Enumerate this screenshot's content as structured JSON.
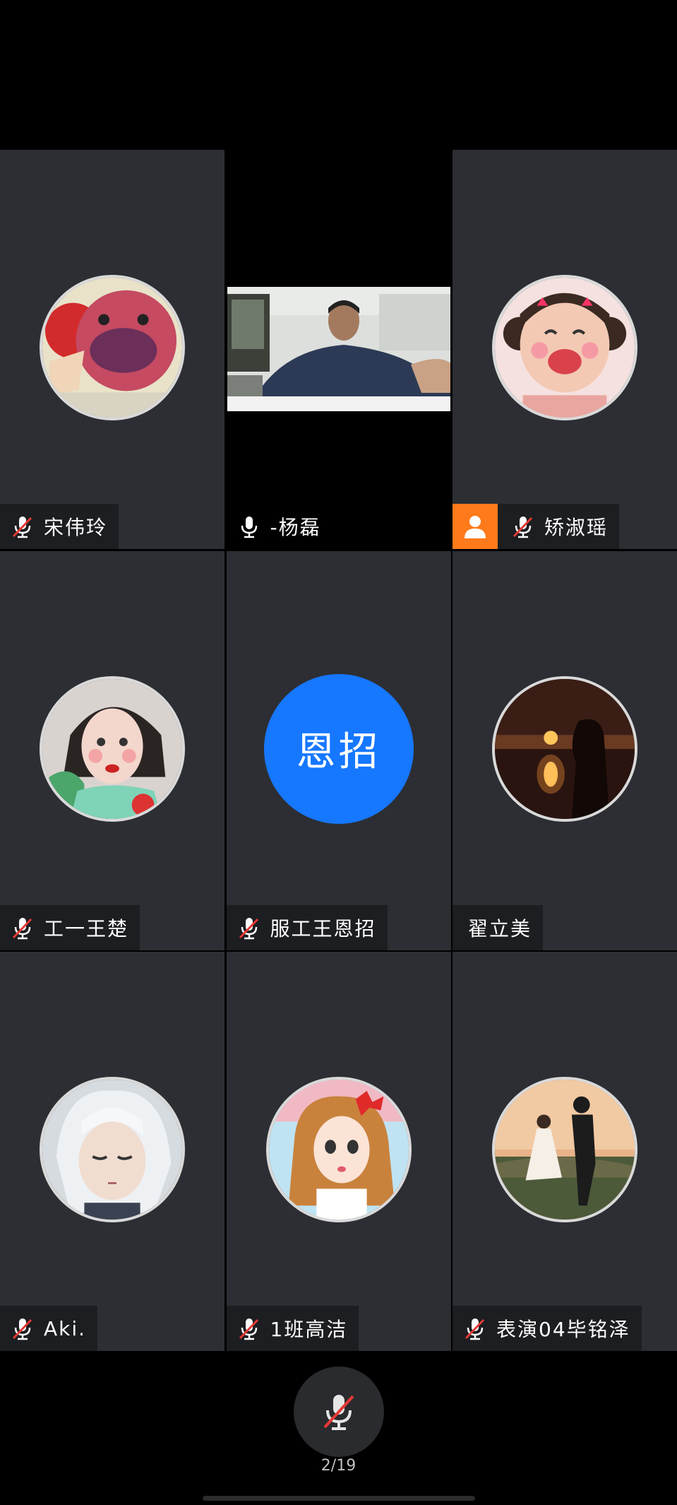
{
  "participants": [
    {
      "name": "宋伟玲",
      "mic": "muted",
      "type": "avatar",
      "avatar_icon": "strawberry-bear-avatar"
    },
    {
      "name": "-杨磊",
      "mic": "on",
      "type": "video"
    },
    {
      "name": "矫淑瑶",
      "mic": "muted",
      "type": "avatar",
      "host": true,
      "avatar_icon": "laughing-girl-avatar"
    },
    {
      "name": "工一王楚",
      "mic": "muted",
      "type": "avatar",
      "avatar_icon": "girl-portrait-avatar"
    },
    {
      "name": "服工王恩招",
      "mic": "muted",
      "type": "initials",
      "initials": "恩招"
    },
    {
      "name": "翟立美",
      "mic": "none",
      "type": "avatar",
      "avatar_icon": "sunset-silhouette-avatar"
    },
    {
      "name": "Aki.",
      "mic": "muted",
      "type": "avatar",
      "avatar_icon": "white-hair-anime-avatar"
    },
    {
      "name": "1班高洁",
      "mic": "muted",
      "type": "avatar",
      "avatar_icon": "cartoon-girl-bow-avatar"
    },
    {
      "name": "表演04毕铭泽",
      "mic": "muted",
      "type": "avatar",
      "avatar_icon": "couple-sunset-avatar"
    }
  ],
  "toolbar": {
    "page_indicator": "2/19"
  },
  "colors": {
    "tile_bg": "#2c2e33",
    "initials_bg": "#1677ff",
    "host_badge": "#ff7a1a",
    "mute_slash": "#e53935"
  }
}
